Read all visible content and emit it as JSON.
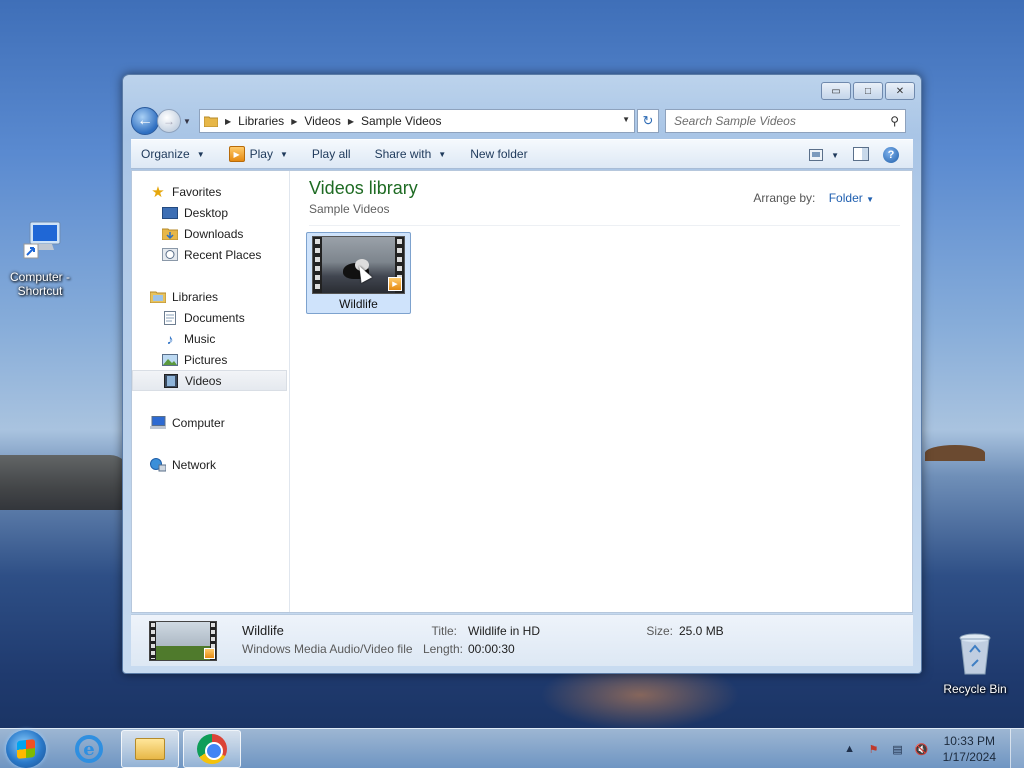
{
  "desktop": {
    "icons": [
      {
        "label": "Computer - Shortcut"
      },
      {
        "label": "Recycle Bin"
      }
    ]
  },
  "window": {
    "controls": {
      "minimize": "▭",
      "maximize": "□",
      "close": "✕"
    },
    "address": {
      "crumbs": [
        "Libraries",
        "Videos",
        "Sample Videos"
      ]
    },
    "search": {
      "placeholder": "Search Sample Videos"
    },
    "toolbar": {
      "organize": "Organize",
      "play": "Play",
      "play_all": "Play all",
      "share_with": "Share with",
      "new_folder": "New folder"
    },
    "nav": {
      "favorites": "Favorites",
      "desktop": "Desktop",
      "downloads": "Downloads",
      "recent_places": "Recent Places",
      "libraries": "Libraries",
      "documents": "Documents",
      "music": "Music",
      "pictures": "Pictures",
      "videos": "Videos",
      "computer": "Computer",
      "network": "Network"
    },
    "content": {
      "title": "Videos library",
      "subtitle": "Sample Videos",
      "arrange_label": "Arrange by:",
      "arrange_value": "Folder",
      "files": [
        {
          "name": "Wildlife"
        }
      ]
    },
    "details": {
      "name": "Wildlife",
      "type": "Windows Media Audio/Video file",
      "title_label": "Title:",
      "title_value": "Wildlife in HD",
      "length_label": "Length:",
      "length_value": "00:00:30",
      "size_label": "Size:",
      "size_value": "25.0 MB"
    }
  },
  "taskbar": {
    "clock": {
      "time": "10:33 PM",
      "date": "1/17/2024"
    }
  },
  "colors": {
    "library_title": "#1e6b23",
    "selection": "#cfe3fb",
    "link": "#1f5fb0"
  }
}
